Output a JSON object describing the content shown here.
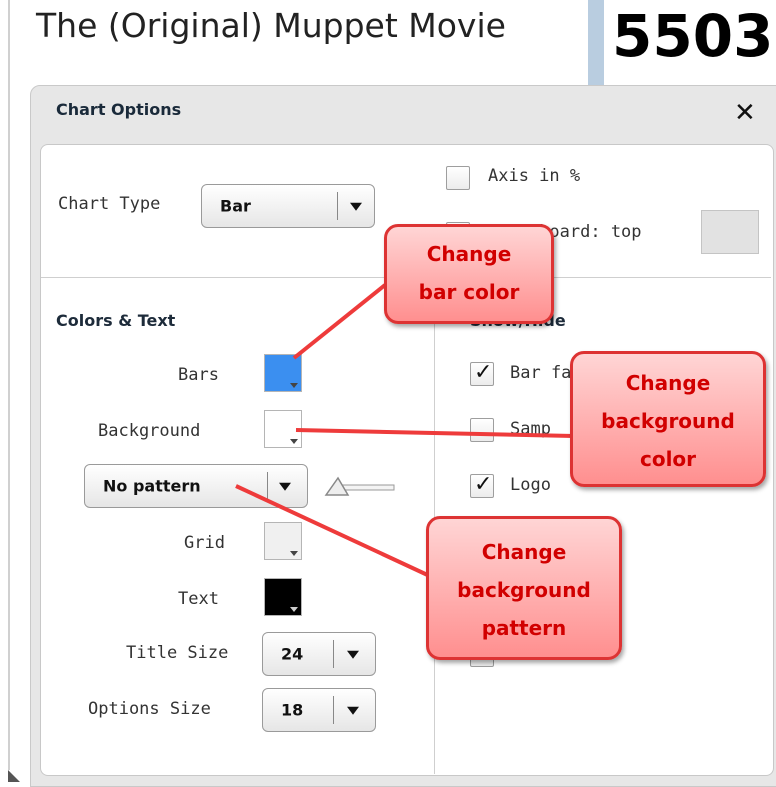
{
  "background_page": {
    "title": "The (Original) Muppet Movie",
    "number": "5503"
  },
  "dialog": {
    "title": "Chart Options",
    "close_icon": "✕"
  },
  "chart_type": {
    "label": "Chart Type",
    "value": "Bar"
  },
  "top_options": {
    "axis_percent_label": "Axis in %",
    "axis_percent_checked": false,
    "scoreboard_label": "Scoreboard: top",
    "scoreboard_checked": false
  },
  "colors_text": {
    "heading": "Colors & Text",
    "bars_label": "Bars",
    "bars_color": "#3b8ff0",
    "background_label": "Background",
    "background_color": "#ffffff",
    "pattern_value": "No pattern",
    "grid_label": "Grid",
    "grid_color": "#f0f0f0",
    "text_label": "Text",
    "text_color": "#000000",
    "title_size_label": "Title Size",
    "title_size_value": "24",
    "options_size_label": "Options Size",
    "options_size_value": "18"
  },
  "show_hide": {
    "heading": "Show/Hide",
    "items": [
      {
        "label": "Bar fa",
        "checked": true
      },
      {
        "label": "Samp",
        "checked": false
      },
      {
        "label": "Logo",
        "checked": true
      },
      {
        "label": "",
        "checked": false
      }
    ]
  },
  "callouts": {
    "bar_color": [
      "Change",
      "bar color"
    ],
    "background_color": [
      "Change",
      "background",
      "color"
    ],
    "background_pattern": [
      "Change",
      "background",
      "pattern"
    ]
  }
}
